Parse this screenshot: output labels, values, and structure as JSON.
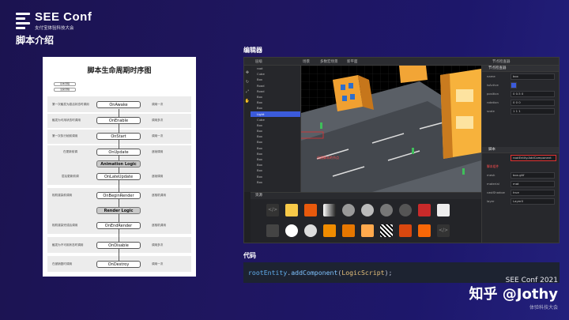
{
  "brand": {
    "title": "SEE Conf",
    "subtitle": "支付宝体验科技大会"
  },
  "section_title": "脚本介绍",
  "diagram": {
    "title": "脚本生命周期时序图",
    "legend": [
      "基本流程",
      "渲染流程"
    ],
    "nodes": [
      "OnAwake",
      "OnEnable",
      "OnStart",
      "OnUpdate",
      "Animation Logic",
      "OnLateUpdate",
      "OnBeginRender",
      "Render Logic",
      "OnEndRender",
      "OnDisable",
      "OnDestroy"
    ],
    "left_notes": [
      "第一次触发为激活状态时调用",
      "触发为可用状态时调用",
      "第一次执行帧前调用",
      "在更新前调",
      "层后更新前调",
      "相机渲染前调用",
      "相机渲染完成后调用",
      "触发为不可用状态时调用",
      "在被销毁时调用"
    ],
    "right_notes": [
      "调用一次",
      "调用多次",
      "调用一次",
      "逐帧调用",
      "逐帧调用",
      "逐相机调用",
      "逐相机调用",
      "调用多次",
      "调用一次"
    ]
  },
  "editor": {
    "label": "编辑器",
    "tabs": [
      "层级",
      "场景",
      "多数宏场景",
      "新平面"
    ],
    "inspector_title": "节点检查器",
    "hierarchy_rows": [
      "root",
      "Cube",
      "Box",
      "Road",
      "Road",
      "Box",
      "Box",
      "Box",
      "Light",
      "Cube",
      "Box",
      "Box",
      "Box",
      "Box",
      "Box",
      "Box",
      "Box",
      "Box",
      "Box",
      "Box",
      "Box"
    ],
    "annotation_left": "创建脚本的节点",
    "annotation_right": "脚本组件",
    "inspector_rows": [
      {
        "k": "name",
        "v": "box"
      },
      {
        "k": "isActive",
        "v": ""
      },
      {
        "k": "position",
        "v": "0   0.5   0"
      },
      {
        "k": "rotation",
        "v": "0   0   0"
      },
      {
        "k": "scale",
        "v": "1   1   1"
      }
    ],
    "component_header": "脚本",
    "component_value": "rootEntity.AddComponent",
    "component_rows": [
      {
        "k": "mesh",
        "v": "box.gltf"
      },
      {
        "k": "material",
        "v": "mat"
      },
      {
        "k": "castShadow",
        "v": "true"
      },
      {
        "k": "layer",
        "v": "Layer0"
      }
    ],
    "assets_title": "资源"
  },
  "code": {
    "label": "代码",
    "obj": "rootEntity",
    "dot": ".",
    "method": "addComponent",
    "open": "(",
    "cls": "LogicScript",
    "close": ");"
  },
  "watermark": {
    "event": "SEE Conf 2021",
    "handle": "知乎 @Jothy",
    "note": "体验科技大会"
  }
}
